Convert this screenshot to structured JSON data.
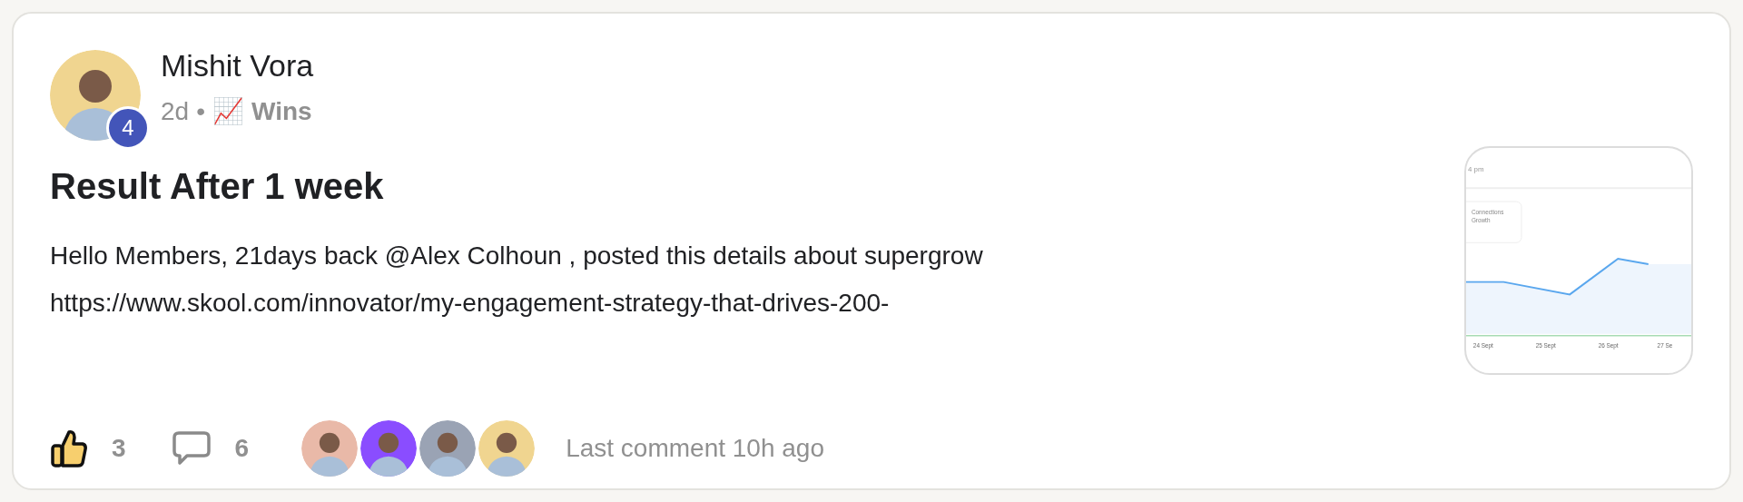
{
  "post": {
    "author": "Mishit Vora",
    "level_badge": "4",
    "time": "2d",
    "separator": "•",
    "category_emoji": "📈",
    "category": "Wins",
    "title": "Result After 1 week",
    "body_lines": [
      "Hello Members, 21days back @Alex Colhoun , posted this details about supergrow",
      "https://www.skool.com/innovator/my-engagement-strategy-that-drives-200-"
    ],
    "thumbnail": {
      "header_text": "4 pm",
      "card_label": "Connections Growth",
      "x_labels": [
        "24 Sept",
        "25 Sept",
        "26 Sept",
        "27 Se"
      ]
    },
    "likes": "3",
    "comments": "6",
    "commenters": [
      {
        "color": "#e9b9a8"
      },
      {
        "color": "#8a4dff"
      },
      {
        "color": "#9aa3b4"
      },
      {
        "color": "#f0d590"
      }
    ],
    "last_comment": "Last comment 10h ago"
  }
}
